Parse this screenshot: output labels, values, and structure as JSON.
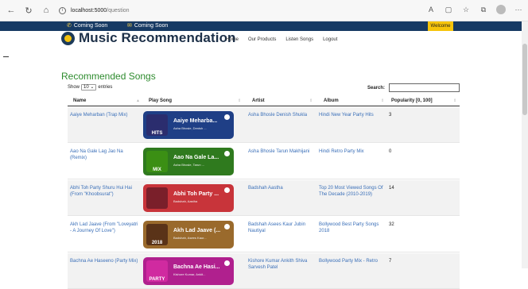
{
  "browser": {
    "url_host": "localhost:5000",
    "url_path": "/question"
  },
  "topbar": {
    "phone_label": "Coming Soon",
    "email_label": "Coming Soon",
    "welcome_label": "Welcome"
  },
  "header": {
    "brand": "Music Recommendation",
    "nav": [
      "Home",
      "Our Products",
      "Listen Songs",
      "Logout"
    ]
  },
  "section": {
    "title": "Recommended Songs",
    "show_label": "Show",
    "entries_value": "10",
    "entries_label": "entries",
    "search_label": "Search:",
    "search_value": ""
  },
  "table": {
    "columns": [
      "Name",
      "Play Song",
      "Artist",
      "Album",
      "Popularity [0, 100]"
    ],
    "rows": [
      {
        "name": "Aaiye Meharban (Trap Mix)",
        "player_title": "Aaiye Meharba...",
        "player_sub": "Asha Bhosle, Denish ...",
        "artist": "Asha Bhosle Denish Shukla",
        "album": "Hindi New Year Party Hits",
        "popularity": "3",
        "color": "#1f3f86",
        "art_color": "#2b2d6e",
        "art_text": "HITS"
      },
      {
        "name": "Aao Na Gale Lag Jao Na (Remix)",
        "player_title": "Aao Na Gale La...",
        "player_sub": "Asha Bhosle, Tarun ...",
        "artist": "Asha Bhosle Tarun Makhijani",
        "album": "Hindi Retro Party Mix",
        "popularity": "0",
        "color": "#2f7a1e",
        "art_color": "#3b8f14",
        "art_text": "MIX"
      },
      {
        "name": "Abhi Toh Party Shuru Hui Hai (From \"Khoobsurat\")",
        "player_title": "Abhi Toh Party ...",
        "player_sub": "Badshah, Aastha",
        "artist": "Badshah Aastha",
        "album": "Top 20 Most Viewed Songs Of The Decade (2010-2019)",
        "popularity": "14",
        "color": "#c8343a",
        "art_color": "#7a1f2a",
        "art_text": ""
      },
      {
        "name": "Akh Lad Jaave (From \"Loveyatri - A Journey Of Love\")",
        "player_title": "Akh Lad Jaave (...",
        "player_sub": "Badshah, Asees Kaur...",
        "artist": "Badshah Asees Kaur Jubin Nautiyal",
        "album": "Bollywood Best Party Songs 2018",
        "popularity": "32",
        "color": "#9a6a2c",
        "art_color": "#5a3318",
        "art_text": "2018"
      },
      {
        "name": "Bachna Ae Haseeno (Party Mix)",
        "player_title": "Bachna Ae Hasi...",
        "player_sub": "Kishore Kumar, Ankit...",
        "artist": "Kishore Kumar Ankith Shiva Sarvesh Patel",
        "album": "Bollywood Party Mix - Retro",
        "popularity": "7",
        "color": "#b0208e",
        "art_color": "#d02aa0",
        "art_text": "PARTY"
      }
    ]
  }
}
